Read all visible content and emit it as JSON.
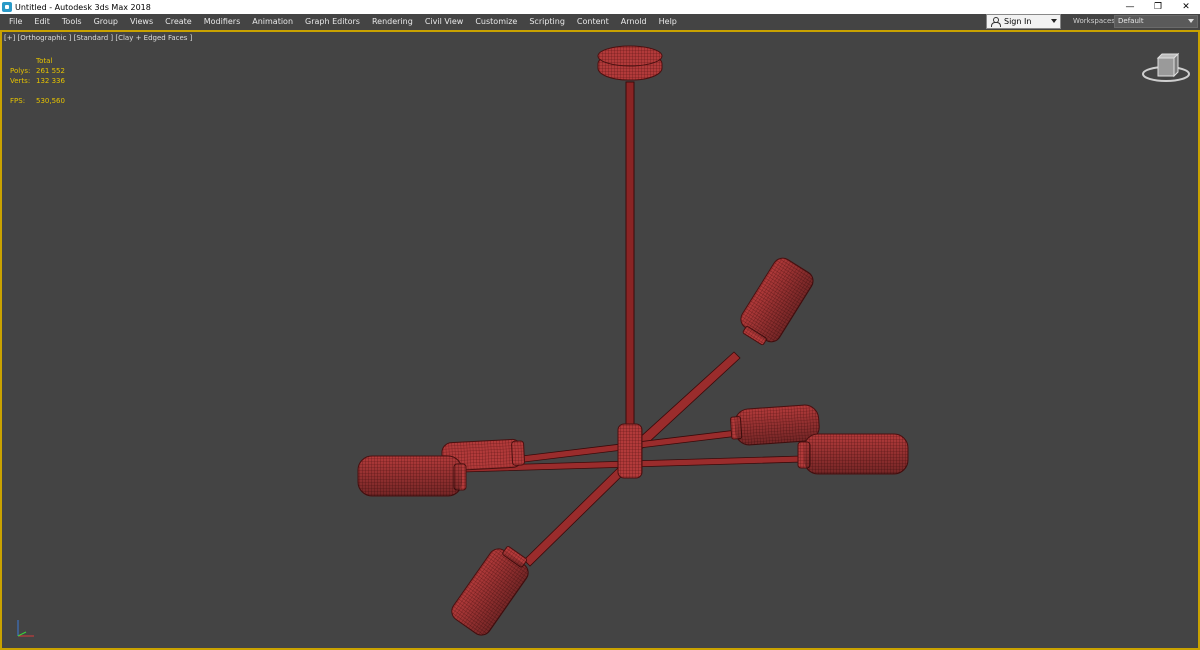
{
  "window": {
    "title": "Untitled - Autodesk 3ds Max 2018",
    "controls": [
      "—",
      "❐",
      "✕"
    ]
  },
  "menu": {
    "items": [
      "File",
      "Edit",
      "Tools",
      "Group",
      "Views",
      "Create",
      "Modifiers",
      "Animation",
      "Graph Editors",
      "Rendering",
      "Civil View",
      "Customize",
      "Scripting",
      "Content",
      "Arnold",
      "Help"
    ]
  },
  "account": {
    "signin_label": "Sign In",
    "workspaces_label": "Workspaces:",
    "workspace_value": "Default"
  },
  "viewport": {
    "label": "[+] [Orthographic ] [Standard ] [Clay + Edged Faces ]",
    "stats": {
      "header": "Total",
      "polys_label": "Polys:",
      "polys_value": "261 552",
      "verts_label": "Verts:",
      "verts_value": "132 336",
      "fps_label": "FPS:",
      "fps_value": "530,560"
    },
    "border_color": "#c9a200",
    "model_color": "#b23a3a"
  }
}
